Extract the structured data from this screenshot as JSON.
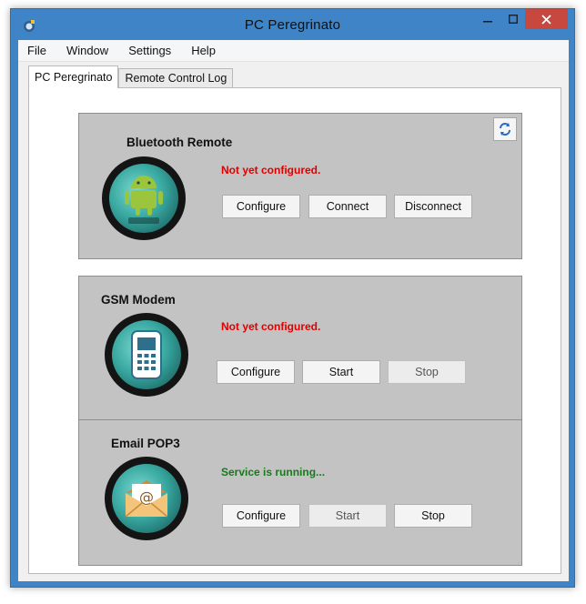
{
  "window": {
    "title": "PC Peregrinato"
  },
  "menu": {
    "items": [
      "File",
      "Window",
      "Settings",
      "Help"
    ]
  },
  "tabs": [
    {
      "label": "PC Peregrinato",
      "active": true
    },
    {
      "label": "Remote Control Log",
      "active": false
    }
  ],
  "cards": [
    {
      "title": "Bluetooth Remote",
      "status": "Not yet configured.",
      "status_color": "#e00000",
      "icon": "android-icon",
      "buttons": [
        {
          "label": "Configure",
          "enabled": true
        },
        {
          "label": "Connect",
          "enabled": true
        },
        {
          "label": "Disconnect",
          "enabled": true
        }
      ]
    },
    {
      "title": "GSM Modem",
      "status": "Not yet configured.",
      "status_color": "#e00000",
      "icon": "mobile-phone-icon",
      "buttons": [
        {
          "label": "Configure",
          "enabled": true
        },
        {
          "label": "Start",
          "enabled": true
        },
        {
          "label": "Stop",
          "enabled": false
        }
      ]
    },
    {
      "title": "Email POP3",
      "status": "Service is running...",
      "status_color": "#197a1d",
      "icon": "envelope-icon",
      "buttons": [
        {
          "label": "Configure",
          "enabled": true
        },
        {
          "label": "Start",
          "enabled": false
        },
        {
          "label": "Stop",
          "enabled": true
        }
      ]
    }
  ],
  "colors": {
    "titlebar": "#3e84c6",
    "close_button": "#c7483f",
    "card_background": "#c3c3c3"
  }
}
